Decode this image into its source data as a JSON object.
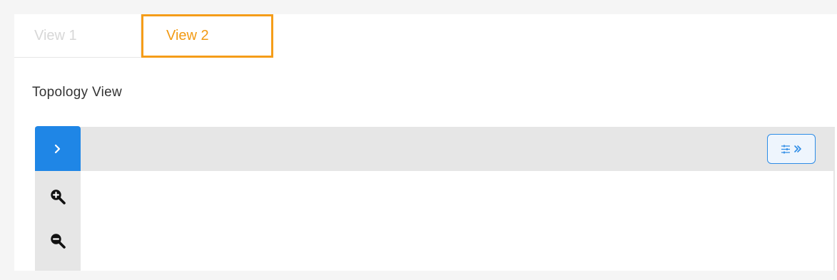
{
  "tabs": [
    {
      "label": "View 1",
      "active": false
    },
    {
      "label": "View 2",
      "active": true
    }
  ],
  "section": {
    "title": "Topology View"
  },
  "toolbar": {
    "expand_icon": "chevron-right-icon",
    "settings_icon": "sliders-icon",
    "settings_chevron_icon": "double-chevron-right-icon",
    "zoom_in_icon": "zoom-in-icon",
    "zoom_out_icon": "zoom-out-icon"
  },
  "colors": {
    "active_tab": "#f29a13",
    "inactive_tab_text": "#d7d7d7",
    "primary_button": "#1f86e6",
    "toolbar_background": "#e6e6e6",
    "settings_border": "#2d8ce6"
  }
}
